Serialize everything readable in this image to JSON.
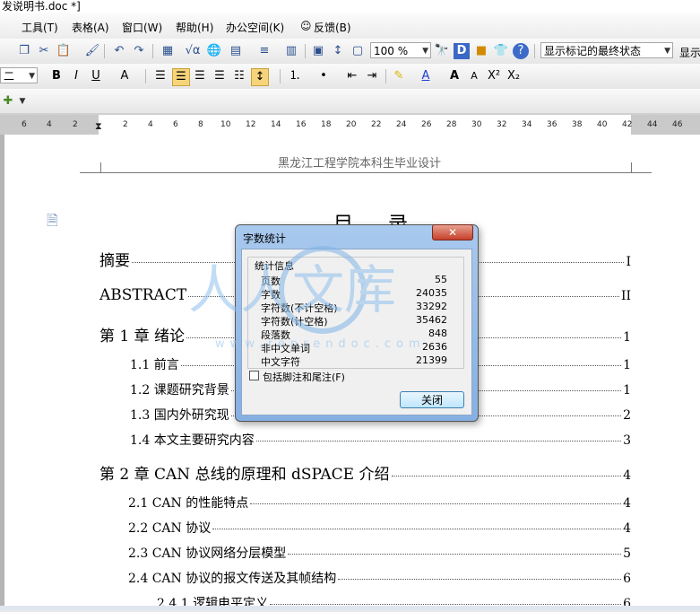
{
  "window": {
    "title": "发说明书.doc *]"
  },
  "menu": [
    {
      "label": "工具(T)"
    },
    {
      "label": "表格(A)"
    },
    {
      "label": "窗口(W)"
    },
    {
      "label": "帮助(H)"
    },
    {
      "label": "办公空间(K)"
    },
    {
      "label": "反馈(B)"
    }
  ],
  "toolbar1": {
    "zoom": "100 %",
    "markup_state": "显示标记的最终状态",
    "show_label": "显示"
  },
  "toolbar2": {
    "font_size": "二",
    "bold": "B",
    "italic": "I",
    "underline": "U",
    "grow": "A",
    "shrink": "A",
    "superscript": "X²",
    "subscript": "X₂"
  },
  "ruler": {
    "ticks": [
      "6",
      "4",
      "2",
      "2",
      "4",
      "6",
      "8",
      "10",
      "12",
      "14",
      "16",
      "18",
      "20",
      "22",
      "24",
      "26",
      "28",
      "30",
      "32",
      "34",
      "36",
      "38",
      "40",
      "42",
      "44",
      "46"
    ]
  },
  "document": {
    "header": "黑龙江工程学院本科生毕业设计",
    "title": "目 录",
    "toc": [
      {
        "label": "摘要",
        "page": "I"
      },
      {
        "label": "ABSTRACT",
        "page": "II"
      },
      {
        "label": "第 1 章  绪论",
        "page": "1"
      },
      {
        "label": "1.1  前言",
        "page": "1"
      },
      {
        "label": "1.2  课题研究背景",
        "page": "1"
      },
      {
        "label": "1.3  国内外研究现",
        "page": "2"
      },
      {
        "label": "1.4  本文主要研究内容",
        "page": "3"
      },
      {
        "label": "第 2 章  CAN 总线的原理和 dSPACE 介绍",
        "page": "4"
      },
      {
        "label": "2.1 CAN 的性能特点",
        "page": "4"
      },
      {
        "label": "2.2 CAN 协议",
        "page": "4"
      },
      {
        "label": "2.3 CAN 协议网络分层模型",
        "page": "5"
      },
      {
        "label": "2.4 CAN 协议的报文传送及其帧结构",
        "page": "6"
      },
      {
        "label": "2.4.1  逻辑电平定义",
        "page": "6"
      }
    ]
  },
  "dialog": {
    "title": "字数统计",
    "close_glyph": "✕",
    "group_label": "统计信息",
    "stats": [
      {
        "label": "页数",
        "value": "55"
      },
      {
        "label": "字数",
        "value": "24035"
      },
      {
        "label": "字符数(不计空格)",
        "value": "33292"
      },
      {
        "label": "字符数(计空格)",
        "value": "35462"
      },
      {
        "label": "段落数",
        "value": "848"
      },
      {
        "label": "非中文单词",
        "value": "2636"
      },
      {
        "label": "中文字符",
        "value": "21399"
      }
    ],
    "checkbox_label": "包括脚注和尾注(F)",
    "checkbox_checked": false,
    "button_label": "关闭"
  },
  "watermark": {
    "text": "人人文库",
    "url": "www.renrendoc.com"
  }
}
